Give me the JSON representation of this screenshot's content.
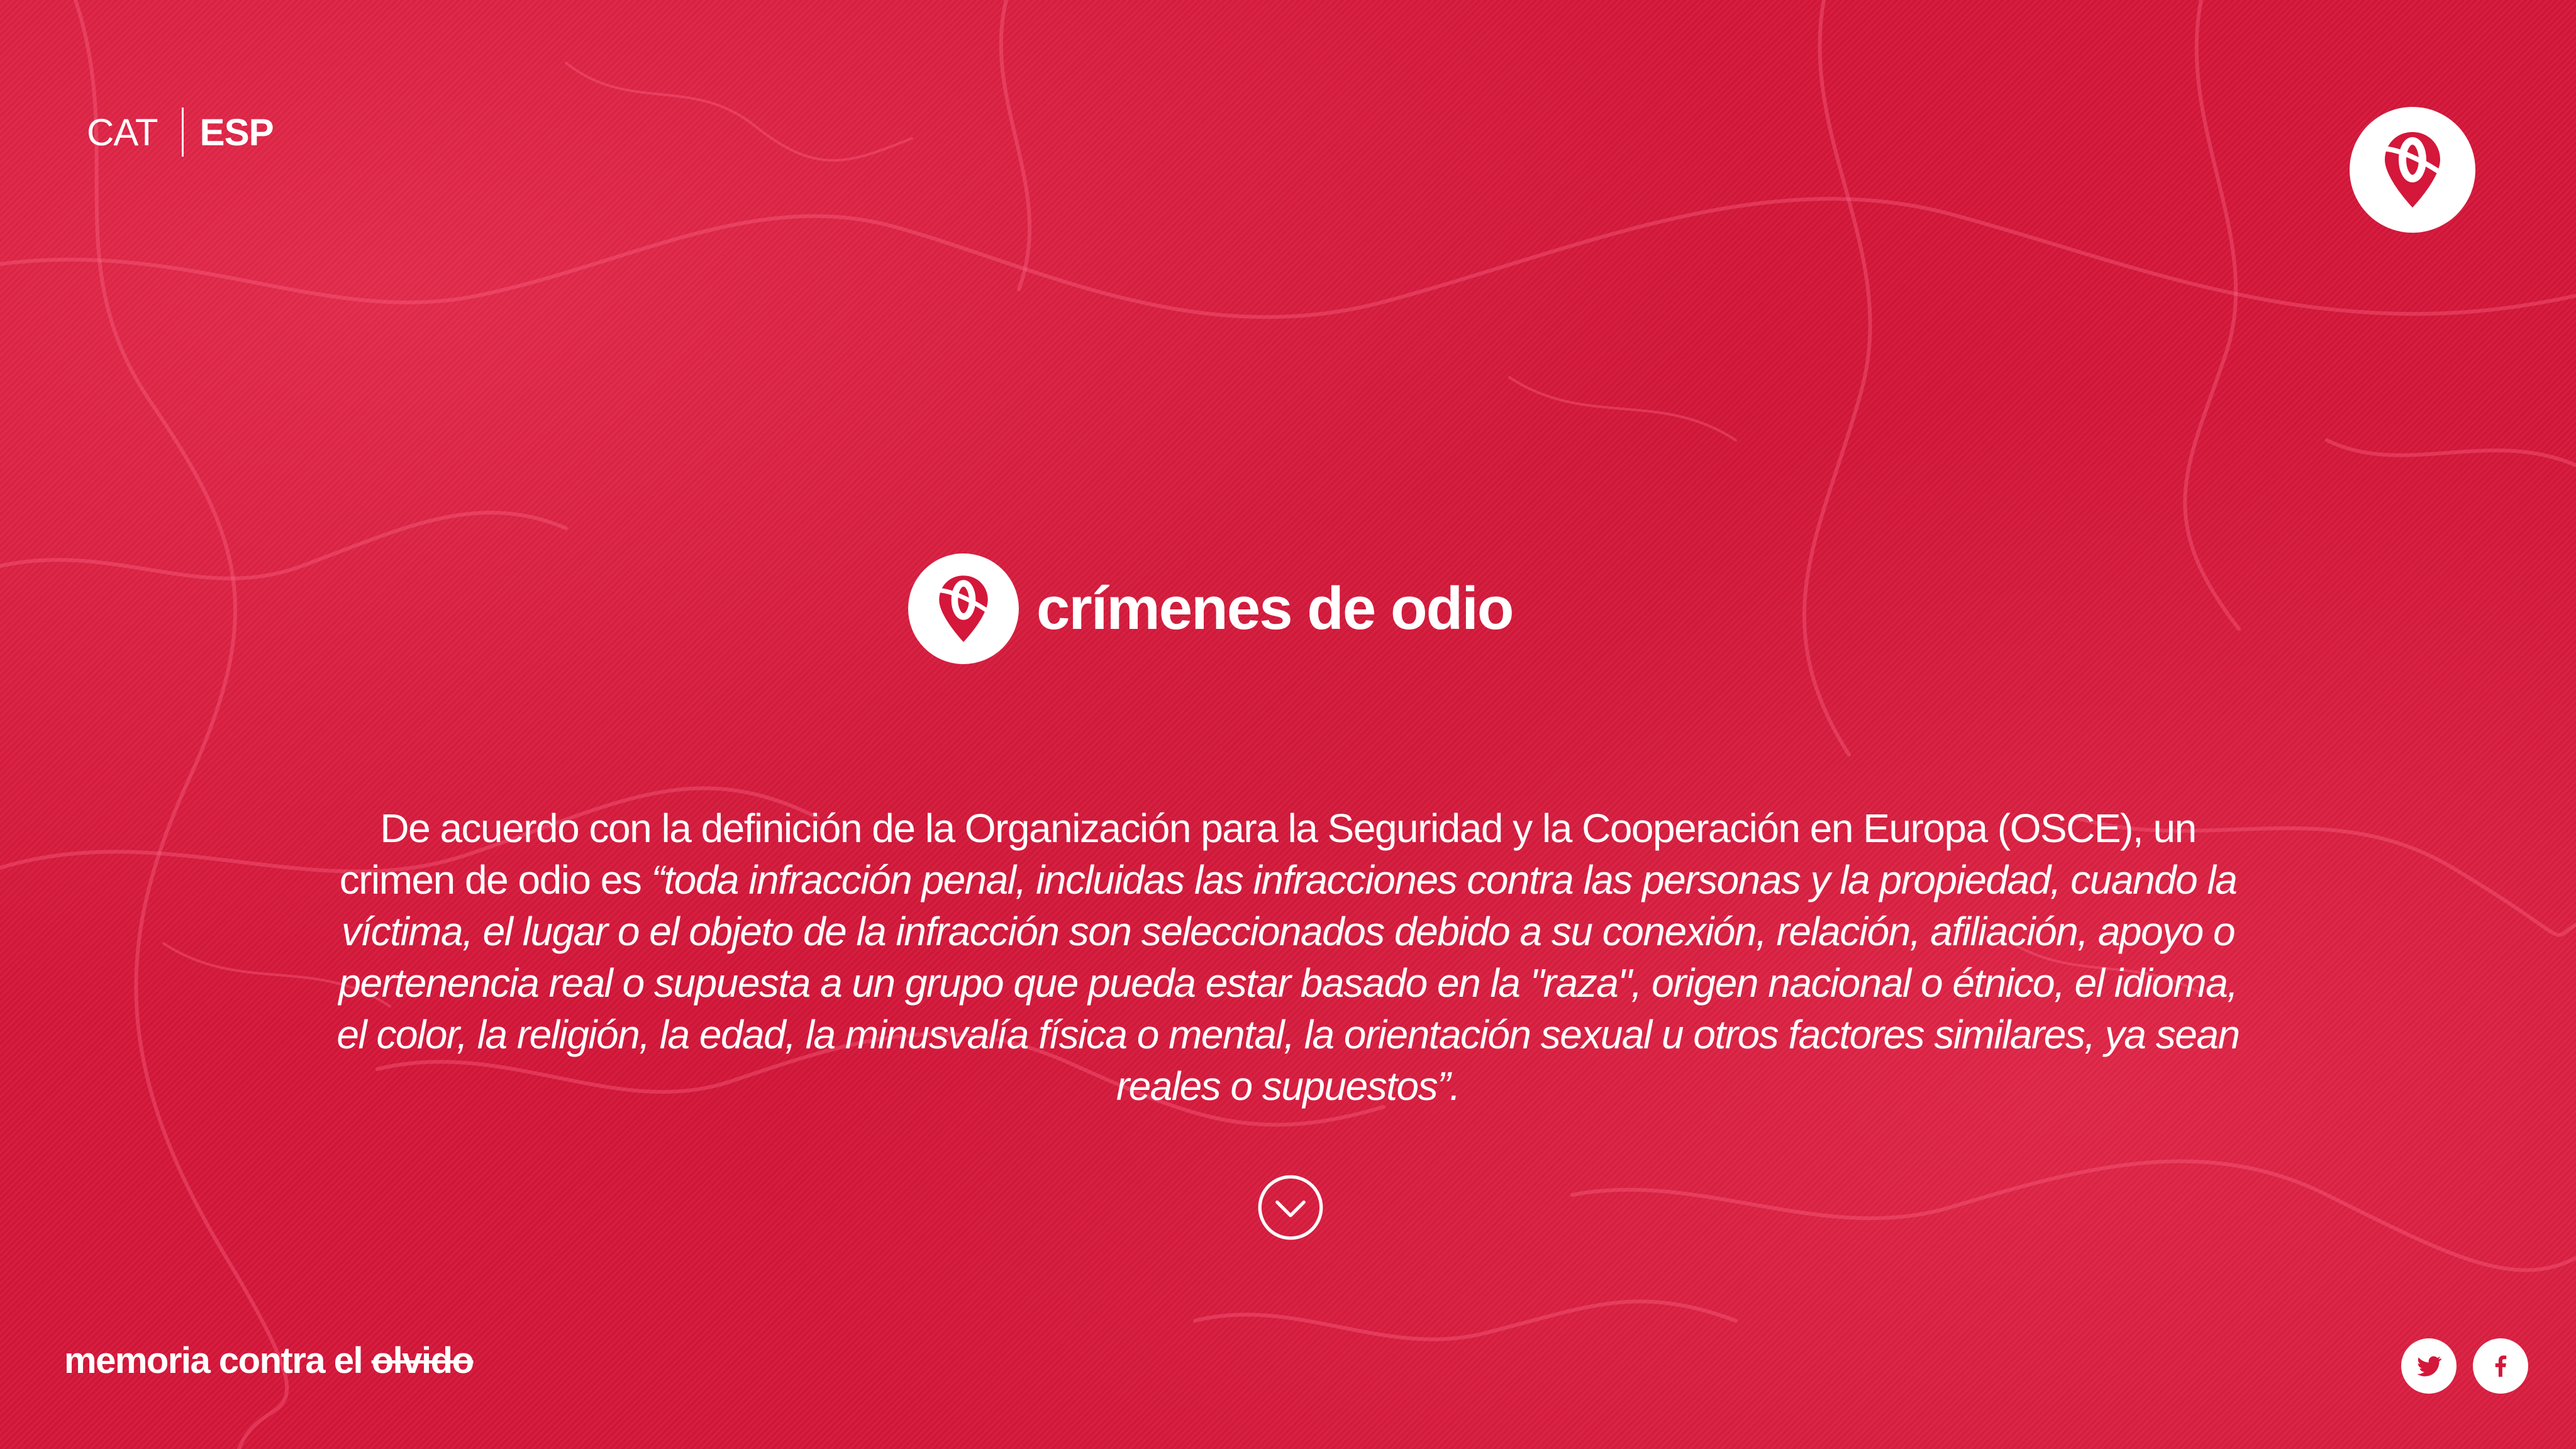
{
  "language_switch": {
    "cat_label": "CAT",
    "esp_label": "ESP",
    "active": "ESP"
  },
  "header": {
    "logo_icon": "location-pin-zero-icon"
  },
  "hero": {
    "title": "crímenes de odio",
    "logo_icon": "location-pin-zero-icon",
    "description_lead": "De acuerdo con la definición de la Organización para la Seguridad y la Cooperación en Europa (OSCE), un crimen de odio es ",
    "description_quote": "“toda infracción penal, incluidas las infracciones contra las personas y la propiedad, cuando la víctima, el lugar o el objeto de la infracción son seleccionados debido a su conexión, relación, afiliación, apoyo o pertenencia real o supuesta a un grupo que pueda estar basado en la \"raza\", origen nacional o étnico, el idioma, el color, la religión, la edad, la minusvalía física o mental, la orientación sexual u otros factores similares, ya sean reales o supuestos”.",
    "scroll_icon": "chevron-down-circle-icon"
  },
  "footer": {
    "tagline_main": "memoria contra el ",
    "tagline_struck": "olvido",
    "social": [
      {
        "name": "twitter",
        "icon": "twitter-icon"
      },
      {
        "name": "facebook",
        "icon": "facebook-icon"
      }
    ]
  },
  "colors": {
    "background": "#d4173a",
    "foreground": "#ffffff"
  }
}
